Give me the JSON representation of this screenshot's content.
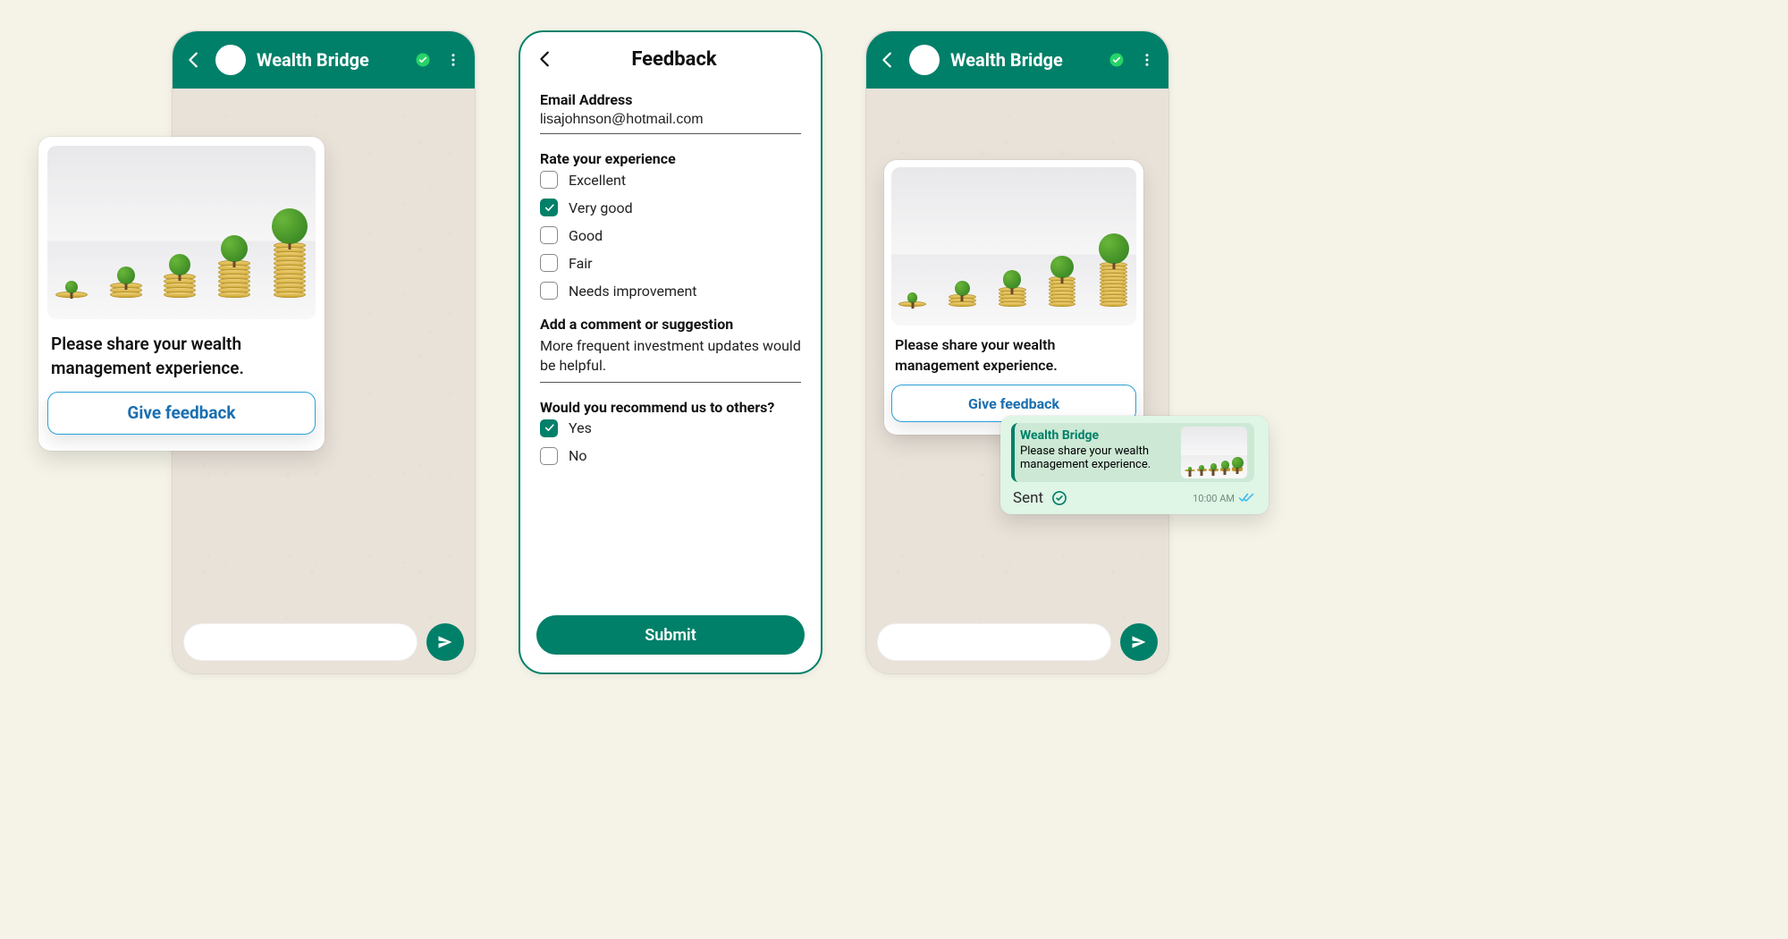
{
  "chat": {
    "title": "Wealth Bridge",
    "message_text": "Please share your wealth management experience.",
    "feedback_button": "Give feedback"
  },
  "feedback_form": {
    "title": "Feedback",
    "email_label": "Email Address",
    "email_value": "lisajohnson@hotmail.com",
    "rating_label": "Rate your experience",
    "ratings": [
      {
        "label": "Excellent",
        "checked": false
      },
      {
        "label": "Very good",
        "checked": true
      },
      {
        "label": "Good",
        "checked": false
      },
      {
        "label": "Fair",
        "checked": false
      },
      {
        "label": "Needs improvement",
        "checked": false
      }
    ],
    "comment_label": "Add a comment or suggestion",
    "comment_value": "More frequent investment updates would be helpful.",
    "recommend_label": "Would you recommend us to others?",
    "recommend": [
      {
        "label": "Yes",
        "checked": true
      },
      {
        "label": "No",
        "checked": false
      }
    ],
    "submit_label": "Submit"
  },
  "reply": {
    "quote_title": "Wealth Bridge",
    "quote_text": "Please share your wealth management experience.",
    "sent_label": "Sent",
    "time": "10:00 AM"
  },
  "plants": [
    {
      "tree": 14,
      "coins": 1
    },
    {
      "tree": 20,
      "coins": 3
    },
    {
      "tree": 24,
      "coins": 5
    },
    {
      "tree": 30,
      "coins": 8
    },
    {
      "tree": 40,
      "coins": 12
    }
  ]
}
